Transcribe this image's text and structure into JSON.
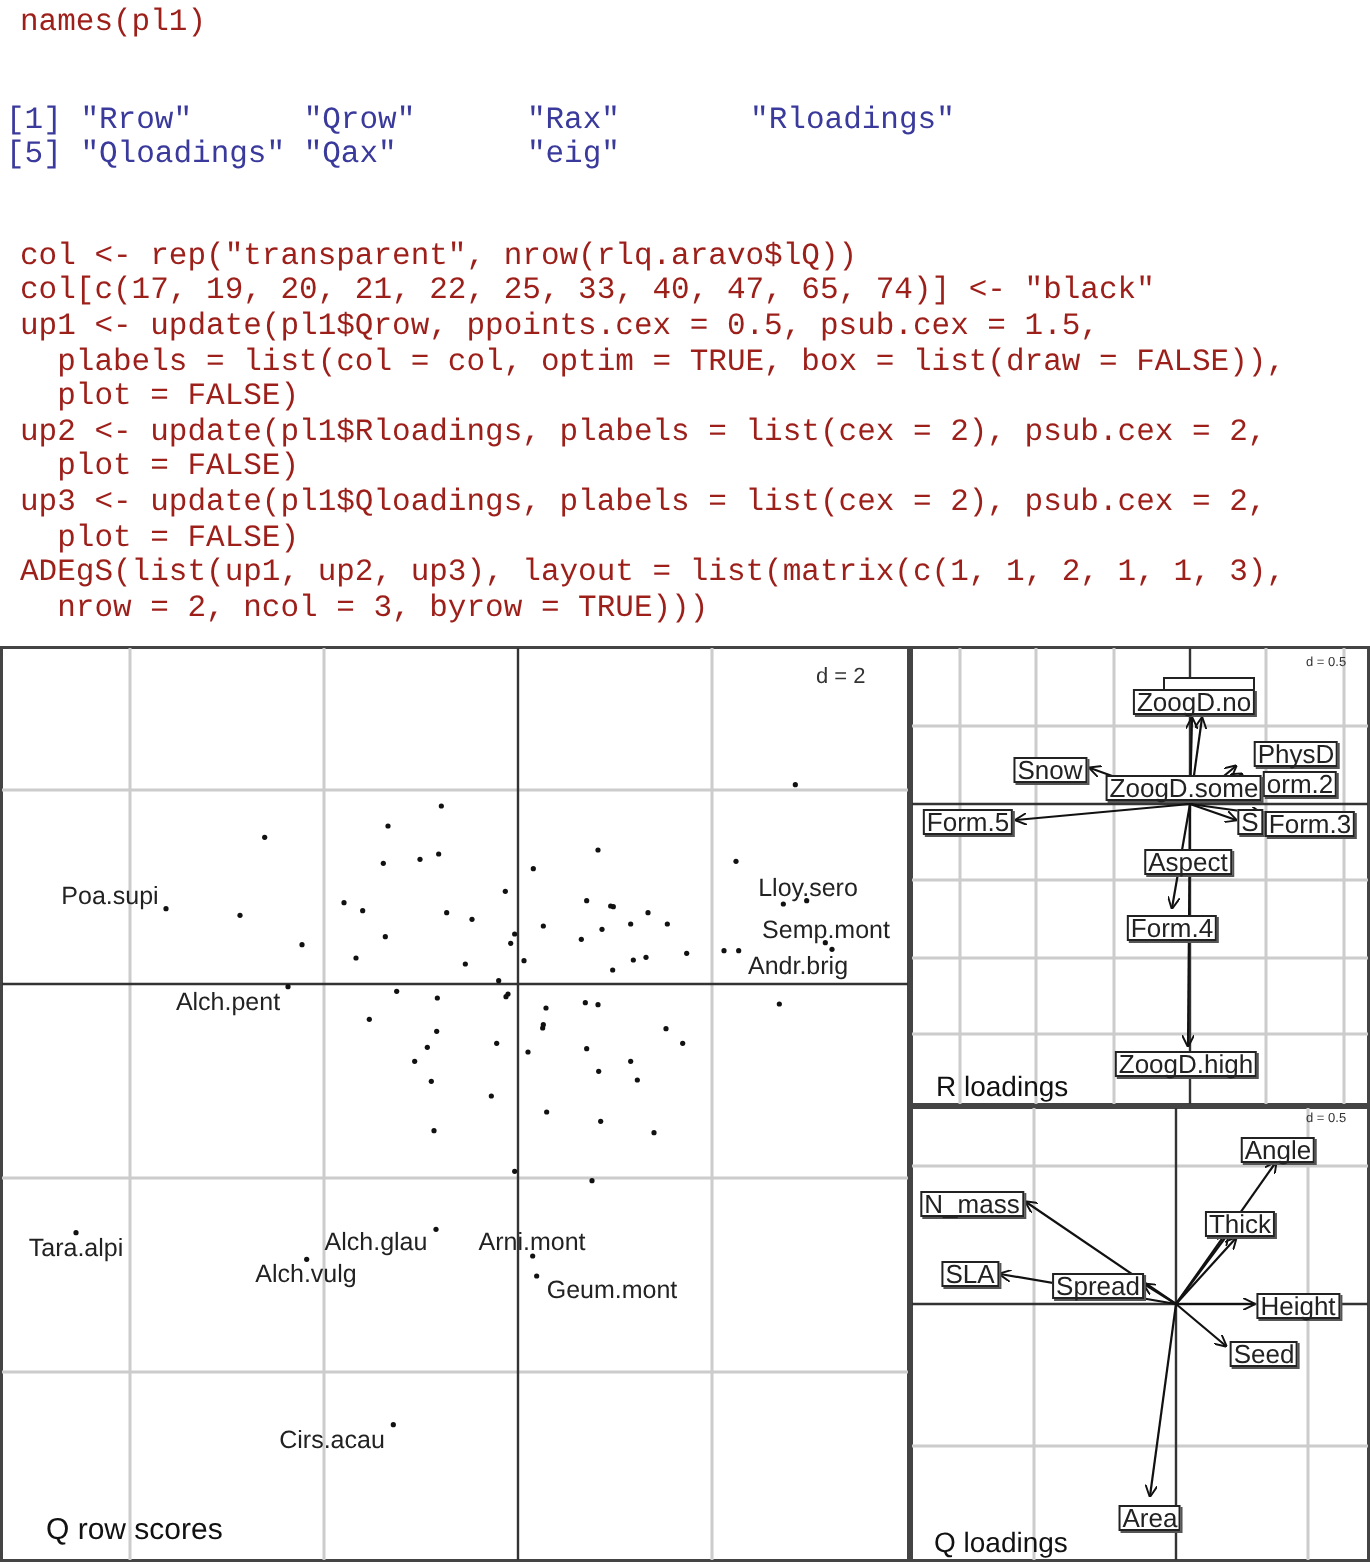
{
  "code_input": "names(pl1)",
  "code_output": [
    "[1] \"Rrow\"      \"Qrow\"      \"Rax\"       \"Rloadings\"",
    "[5] \"Qloadings\" \"Qax\"       \"eig\""
  ],
  "code_block": [
    "col <- rep(\"transparent\", nrow(rlq.aravo$lQ))",
    "col[c(17, 19, 20, 21, 22, 25, 33, 40, 47, 65, 74)] <- \"black\"",
    "up1 <- update(pl1$Qrow, ppoints.cex = 0.5, psub.cex = 1.5,",
    "  plabels = list(col = col, optim = TRUE, box = list(draw = FALSE)),",
    "  plot = FALSE)",
    "up2 <- update(pl1$Rloadings, plabels = list(cex = 2), psub.cex = 2,",
    "  plot = FALSE)",
    "up3 <- update(pl1$Qloadings, plabels = list(cex = 2), psub.cex = 2,",
    "  plot = FALSE)",
    "ADEgS(list(up1, up2, up3), layout = list(matrix(c(1, 1, 2, 1, 1, 3),",
    "  nrow = 2, ncol = 3, byrow = TRUE)))"
  ],
  "panels": [
    {
      "kind": "scores",
      "scale": "d = 2",
      "subtitle": "Q row scores",
      "labels": [
        "Poa.supi",
        "Lloy.sero",
        "Semp.mont",
        "Andr.brig",
        "Alch.pent",
        "Tara.alpi",
        "Alch.glau",
        "Arni.mont",
        "Alch.vulg",
        "Geum.mont",
        "Cirs.acau"
      ]
    },
    {
      "kind": "loadings",
      "scale": "d = 0.5",
      "subtitle": "R loadings",
      "labels": [
        "ZoogD.no",
        "PhysD",
        "orm.2",
        "Snow",
        "ZoogD.some",
        "Form.5",
        "S",
        "Form.3",
        "Aspect",
        "Form.4",
        "ZoogD.high"
      ]
    },
    {
      "kind": "loadings",
      "scale": "d = 0.5",
      "subtitle": "Q loadings",
      "labels": [
        "Angle",
        "N_mass",
        "Thick",
        "SLA",
        "Spread",
        "Height",
        "Seed",
        "Area"
      ]
    }
  ]
}
